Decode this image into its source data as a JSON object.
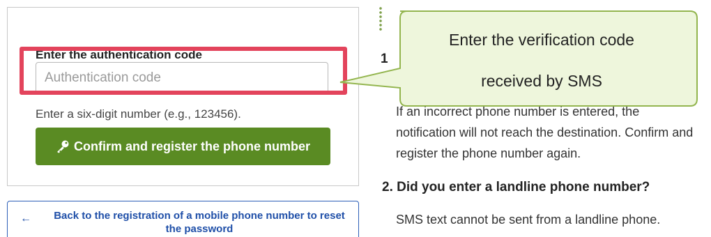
{
  "form": {
    "field_label": "Enter the authentication code",
    "input_placeholder": "Authentication code",
    "input_value": "",
    "help_text": "Enter a six-digit number (e.g., 123456).",
    "confirm_button_label": "Confirm and register the phone number",
    "confirm_button_icon": "key-icon"
  },
  "back_link": {
    "arrow": "←",
    "label": "Back to the registration of a mobile phone number to reset the password"
  },
  "callout": {
    "line1": "Enter the verification code",
    "line2": "received by SMS"
  },
  "content": {
    "heading_1": "1",
    "paragraph_1": "If an incorrect phone number is entered, the notification will not reach the destination. Confirm and register the phone number again.",
    "heading_2": "2. Did you enter a landline phone number?",
    "paragraph_2": "SMS text cannot be sent from a landline phone."
  },
  "colors": {
    "primary_button": "#5a8b23",
    "highlight": "#e3445c",
    "callout_fill": "#eef6dc",
    "callout_border": "#93b54e",
    "link": "#1f4fa8"
  }
}
